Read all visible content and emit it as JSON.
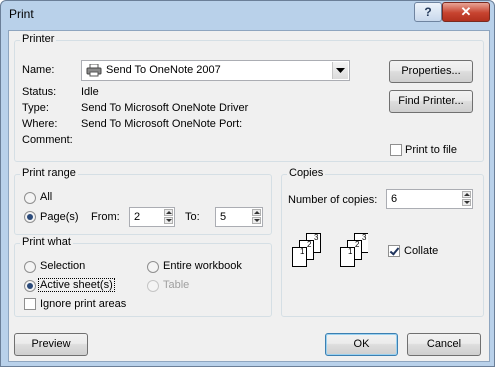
{
  "window": {
    "title": "Print",
    "help_glyph": "?",
    "close_glyph": "✕"
  },
  "printer": {
    "group_label": "Printer",
    "name_label": "Name:",
    "name_value": "Send To OneNote 2007",
    "status_label": "Status:",
    "status_value": "Idle",
    "type_label": "Type:",
    "type_value": "Send To Microsoft OneNote Driver",
    "where_label": "Where:",
    "where_value": "Send To Microsoft OneNote Port:",
    "comment_label": "Comment:",
    "properties_button": "Properties...",
    "find_printer_button": "Find Printer...",
    "print_to_file_label": "Print to file",
    "print_to_file_checked": false
  },
  "print_range": {
    "group_label": "Print range",
    "all_label": "All",
    "pages_label": "Page(s)",
    "selected": "pages",
    "from_label": "From:",
    "from_value": "2",
    "to_label": "To:",
    "to_value": "5"
  },
  "copies": {
    "group_label": "Copies",
    "number_label": "Number of copies:",
    "number_value": "6",
    "collate_label": "Collate",
    "collate_checked": true,
    "collate_page_labels": [
      "1",
      "2",
      "3"
    ]
  },
  "print_what": {
    "group_label": "Print what",
    "selection_label": "Selection",
    "entire_workbook_label": "Entire workbook",
    "active_sheets_label": "Active sheet(s)",
    "table_label": "Table",
    "selected": "active_sheets",
    "ignore_print_areas_label": "Ignore print areas",
    "ignore_print_areas_checked": false
  },
  "footer": {
    "preview_button": "Preview",
    "ok_button": "OK",
    "cancel_button": "Cancel"
  },
  "icons": {
    "printer": "printer-icon",
    "dropdown": "chevron-down-icon",
    "collate": "collate-pages-icon"
  }
}
